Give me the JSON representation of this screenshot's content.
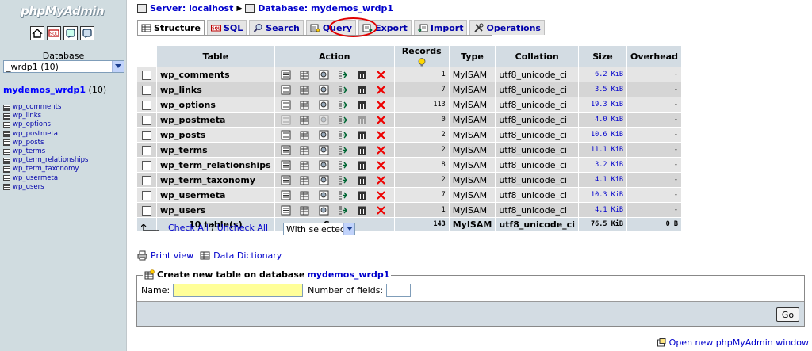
{
  "left": {
    "logo_prefix": "php",
    "logo_main": "MyAdmin",
    "icons": [
      "home-icon",
      "sql-icon",
      "query-window-icon",
      "docs-icon"
    ],
    "database_label": "Database",
    "database_select_value": "_wrdp1 (10)",
    "db_heading_name": "mydemos_wrdp1",
    "db_heading_count": "(10)",
    "tables": [
      "wp_comments",
      "wp_links",
      "wp_options",
      "wp_postmeta",
      "wp_posts",
      "wp_terms",
      "wp_term_relationships",
      "wp_term_taxonomy",
      "wp_usermeta",
      "wp_users"
    ]
  },
  "breadcrumb": {
    "server": "Server: localhost",
    "database": "Database: mydemos_wrdp1"
  },
  "tabs": [
    {
      "label": "Structure",
      "icon": "structure-icon",
      "active": true
    },
    {
      "label": "SQL",
      "icon": "sql-icon",
      "active": false
    },
    {
      "label": "Search",
      "icon": "search-icon",
      "active": false
    },
    {
      "label": "Query",
      "icon": "query-icon",
      "active": false
    },
    {
      "label": "Export",
      "icon": "export-icon",
      "active": false
    },
    {
      "label": "Import",
      "icon": "import-icon",
      "active": false
    },
    {
      "label": "Operations",
      "icon": "operations-icon",
      "active": false
    }
  ],
  "table": {
    "headers": {
      "table": "Table",
      "action": "Action",
      "records": "Records",
      "type": "Type",
      "collation": "Collation",
      "size": "Size",
      "overhead": "Overhead"
    },
    "rows": [
      {
        "name": "wp_comments",
        "records": "1",
        "type": "MyISAM",
        "collation": "utf8_unicode_ci",
        "size": "6.2 KiB",
        "overhead": "-",
        "empty": false
      },
      {
        "name": "wp_links",
        "records": "7",
        "type": "MyISAM",
        "collation": "utf8_unicode_ci",
        "size": "3.5 KiB",
        "overhead": "-",
        "empty": false
      },
      {
        "name": "wp_options",
        "records": "113",
        "type": "MyISAM",
        "collation": "utf8_unicode_ci",
        "size": "19.3 KiB",
        "overhead": "-",
        "empty": false
      },
      {
        "name": "wp_postmeta",
        "records": "0",
        "type": "MyISAM",
        "collation": "utf8_unicode_ci",
        "size": "4.0 KiB",
        "overhead": "-",
        "empty": true
      },
      {
        "name": "wp_posts",
        "records": "2",
        "type": "MyISAM",
        "collation": "utf8_unicode_ci",
        "size": "10.6 KiB",
        "overhead": "-",
        "empty": false
      },
      {
        "name": "wp_terms",
        "records": "2",
        "type": "MyISAM",
        "collation": "utf8_unicode_ci",
        "size": "11.1 KiB",
        "overhead": "-",
        "empty": false
      },
      {
        "name": "wp_term_relationships",
        "records": "8",
        "type": "MyISAM",
        "collation": "utf8_unicode_ci",
        "size": "3.2 KiB",
        "overhead": "-",
        "empty": false
      },
      {
        "name": "wp_term_taxonomy",
        "records": "2",
        "type": "MyISAM",
        "collation": "utf8_unicode_ci",
        "size": "4.1 KiB",
        "overhead": "-",
        "empty": false
      },
      {
        "name": "wp_usermeta",
        "records": "7",
        "type": "MyISAM",
        "collation": "utf8_unicode_ci",
        "size": "10.3 KiB",
        "overhead": "-",
        "empty": false
      },
      {
        "name": "wp_users",
        "records": "1",
        "type": "MyISAM",
        "collation": "utf8_unicode_ci",
        "size": "4.1 KiB",
        "overhead": "-",
        "empty": false
      }
    ],
    "footer": {
      "count": "10 table(s)",
      "sum": "Sum",
      "records": "143",
      "type": "MyISAM",
      "collation": "utf8_unicode_ci",
      "size": "76.5 KiB",
      "overhead": "0 B"
    }
  },
  "check_all": "Check All",
  "slash": " / ",
  "uncheck_all": "Uncheck All",
  "with_selected": "With selected:",
  "print_view": "Print view",
  "data_dictionary": "Data Dictionary",
  "create": {
    "legend": "Create new table on database",
    "database": "mydemos_wrdp1",
    "name_label": "Name:",
    "name_value": "",
    "fields_label": "Number of fields:",
    "fields_value": "",
    "go": "Go"
  },
  "open_new_window": "Open new phpMyAdmin window",
  "colors": {
    "frame_bg": "#d0dce0",
    "header_bg": "#d3dce3",
    "row_odd": "#e5e5e5",
    "row_even": "#d5d5d5",
    "link": "#0000cc",
    "highlight_ring": "#e00000",
    "name_input_bg": "#ffff99"
  }
}
